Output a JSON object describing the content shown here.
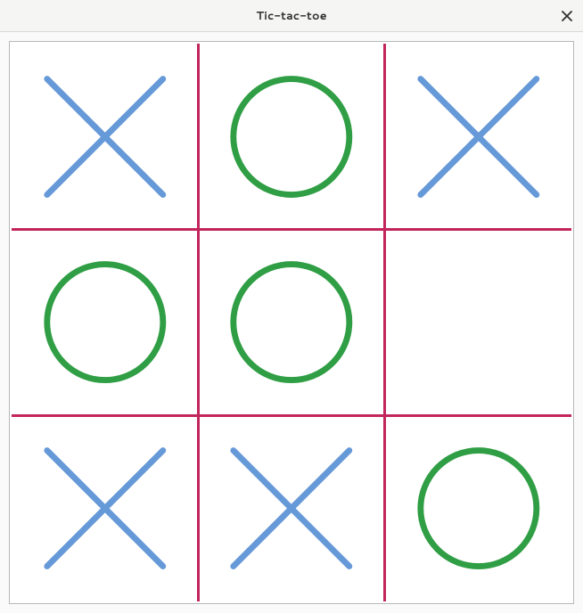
{
  "window": {
    "title": "Tic-tac-toe"
  },
  "game": {
    "rows": 3,
    "cols": 3,
    "grid_color": "#c2255c",
    "x_color": "#6699d8",
    "o_color": "#2f9e44",
    "board": [
      [
        "X",
        "O",
        "X"
      ],
      [
        "O",
        "O",
        ""
      ],
      [
        "X",
        "X",
        "O"
      ]
    ]
  }
}
